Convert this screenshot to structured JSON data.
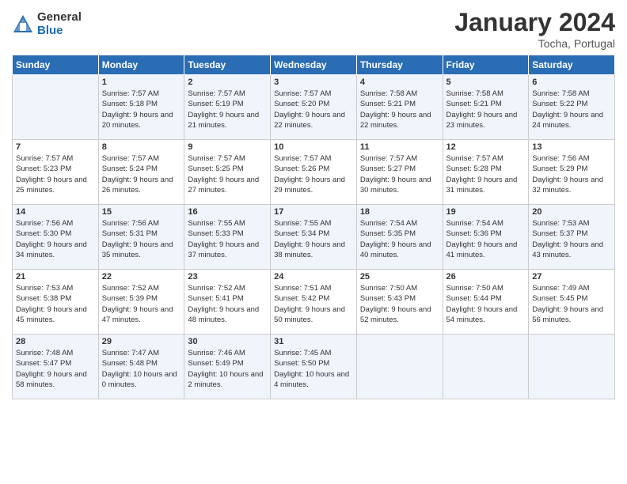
{
  "header": {
    "logo_general": "General",
    "logo_blue": "Blue",
    "title": "January 2024",
    "location": "Tocha, Portugal"
  },
  "days_of_week": [
    "Sunday",
    "Monday",
    "Tuesday",
    "Wednesday",
    "Thursday",
    "Friday",
    "Saturday"
  ],
  "weeks": [
    [
      {
        "day": "",
        "sunrise": "",
        "sunset": "",
        "daylight": ""
      },
      {
        "day": "1",
        "sunrise": "Sunrise: 7:57 AM",
        "sunset": "Sunset: 5:18 PM",
        "daylight": "Daylight: 9 hours and 20 minutes."
      },
      {
        "day": "2",
        "sunrise": "Sunrise: 7:57 AM",
        "sunset": "Sunset: 5:19 PM",
        "daylight": "Daylight: 9 hours and 21 minutes."
      },
      {
        "day": "3",
        "sunrise": "Sunrise: 7:57 AM",
        "sunset": "Sunset: 5:20 PM",
        "daylight": "Daylight: 9 hours and 22 minutes."
      },
      {
        "day": "4",
        "sunrise": "Sunrise: 7:58 AM",
        "sunset": "Sunset: 5:21 PM",
        "daylight": "Daylight: 9 hours and 22 minutes."
      },
      {
        "day": "5",
        "sunrise": "Sunrise: 7:58 AM",
        "sunset": "Sunset: 5:21 PM",
        "daylight": "Daylight: 9 hours and 23 minutes."
      },
      {
        "day": "6",
        "sunrise": "Sunrise: 7:58 AM",
        "sunset": "Sunset: 5:22 PM",
        "daylight": "Daylight: 9 hours and 24 minutes."
      }
    ],
    [
      {
        "day": "7",
        "sunrise": "Sunrise: 7:57 AM",
        "sunset": "Sunset: 5:23 PM",
        "daylight": "Daylight: 9 hours and 25 minutes."
      },
      {
        "day": "8",
        "sunrise": "Sunrise: 7:57 AM",
        "sunset": "Sunset: 5:24 PM",
        "daylight": "Daylight: 9 hours and 26 minutes."
      },
      {
        "day": "9",
        "sunrise": "Sunrise: 7:57 AM",
        "sunset": "Sunset: 5:25 PM",
        "daylight": "Daylight: 9 hours and 27 minutes."
      },
      {
        "day": "10",
        "sunrise": "Sunrise: 7:57 AM",
        "sunset": "Sunset: 5:26 PM",
        "daylight": "Daylight: 9 hours and 29 minutes."
      },
      {
        "day": "11",
        "sunrise": "Sunrise: 7:57 AM",
        "sunset": "Sunset: 5:27 PM",
        "daylight": "Daylight: 9 hours and 30 minutes."
      },
      {
        "day": "12",
        "sunrise": "Sunrise: 7:57 AM",
        "sunset": "Sunset: 5:28 PM",
        "daylight": "Daylight: 9 hours and 31 minutes."
      },
      {
        "day": "13",
        "sunrise": "Sunrise: 7:56 AM",
        "sunset": "Sunset: 5:29 PM",
        "daylight": "Daylight: 9 hours and 32 minutes."
      }
    ],
    [
      {
        "day": "14",
        "sunrise": "Sunrise: 7:56 AM",
        "sunset": "Sunset: 5:30 PM",
        "daylight": "Daylight: 9 hours and 34 minutes."
      },
      {
        "day": "15",
        "sunrise": "Sunrise: 7:56 AM",
        "sunset": "Sunset: 5:31 PM",
        "daylight": "Daylight: 9 hours and 35 minutes."
      },
      {
        "day": "16",
        "sunrise": "Sunrise: 7:55 AM",
        "sunset": "Sunset: 5:33 PM",
        "daylight": "Daylight: 9 hours and 37 minutes."
      },
      {
        "day": "17",
        "sunrise": "Sunrise: 7:55 AM",
        "sunset": "Sunset: 5:34 PM",
        "daylight": "Daylight: 9 hours and 38 minutes."
      },
      {
        "day": "18",
        "sunrise": "Sunrise: 7:54 AM",
        "sunset": "Sunset: 5:35 PM",
        "daylight": "Daylight: 9 hours and 40 minutes."
      },
      {
        "day": "19",
        "sunrise": "Sunrise: 7:54 AM",
        "sunset": "Sunset: 5:36 PM",
        "daylight": "Daylight: 9 hours and 41 minutes."
      },
      {
        "day": "20",
        "sunrise": "Sunrise: 7:53 AM",
        "sunset": "Sunset: 5:37 PM",
        "daylight": "Daylight: 9 hours and 43 minutes."
      }
    ],
    [
      {
        "day": "21",
        "sunrise": "Sunrise: 7:53 AM",
        "sunset": "Sunset: 5:38 PM",
        "daylight": "Daylight: 9 hours and 45 minutes."
      },
      {
        "day": "22",
        "sunrise": "Sunrise: 7:52 AM",
        "sunset": "Sunset: 5:39 PM",
        "daylight": "Daylight: 9 hours and 47 minutes."
      },
      {
        "day": "23",
        "sunrise": "Sunrise: 7:52 AM",
        "sunset": "Sunset: 5:41 PM",
        "daylight": "Daylight: 9 hours and 48 minutes."
      },
      {
        "day": "24",
        "sunrise": "Sunrise: 7:51 AM",
        "sunset": "Sunset: 5:42 PM",
        "daylight": "Daylight: 9 hours and 50 minutes."
      },
      {
        "day": "25",
        "sunrise": "Sunrise: 7:50 AM",
        "sunset": "Sunset: 5:43 PM",
        "daylight": "Daylight: 9 hours and 52 minutes."
      },
      {
        "day": "26",
        "sunrise": "Sunrise: 7:50 AM",
        "sunset": "Sunset: 5:44 PM",
        "daylight": "Daylight: 9 hours and 54 minutes."
      },
      {
        "day": "27",
        "sunrise": "Sunrise: 7:49 AM",
        "sunset": "Sunset: 5:45 PM",
        "daylight": "Daylight: 9 hours and 56 minutes."
      }
    ],
    [
      {
        "day": "28",
        "sunrise": "Sunrise: 7:48 AM",
        "sunset": "Sunset: 5:47 PM",
        "daylight": "Daylight: 9 hours and 58 minutes."
      },
      {
        "day": "29",
        "sunrise": "Sunrise: 7:47 AM",
        "sunset": "Sunset: 5:48 PM",
        "daylight": "Daylight: 10 hours and 0 minutes."
      },
      {
        "day": "30",
        "sunrise": "Sunrise: 7:46 AM",
        "sunset": "Sunset: 5:49 PM",
        "daylight": "Daylight: 10 hours and 2 minutes."
      },
      {
        "day": "31",
        "sunrise": "Sunrise: 7:45 AM",
        "sunset": "Sunset: 5:50 PM",
        "daylight": "Daylight: 10 hours and 4 minutes."
      },
      {
        "day": "",
        "sunrise": "",
        "sunset": "",
        "daylight": ""
      },
      {
        "day": "",
        "sunrise": "",
        "sunset": "",
        "daylight": ""
      },
      {
        "day": "",
        "sunrise": "",
        "sunset": "",
        "daylight": ""
      }
    ]
  ]
}
